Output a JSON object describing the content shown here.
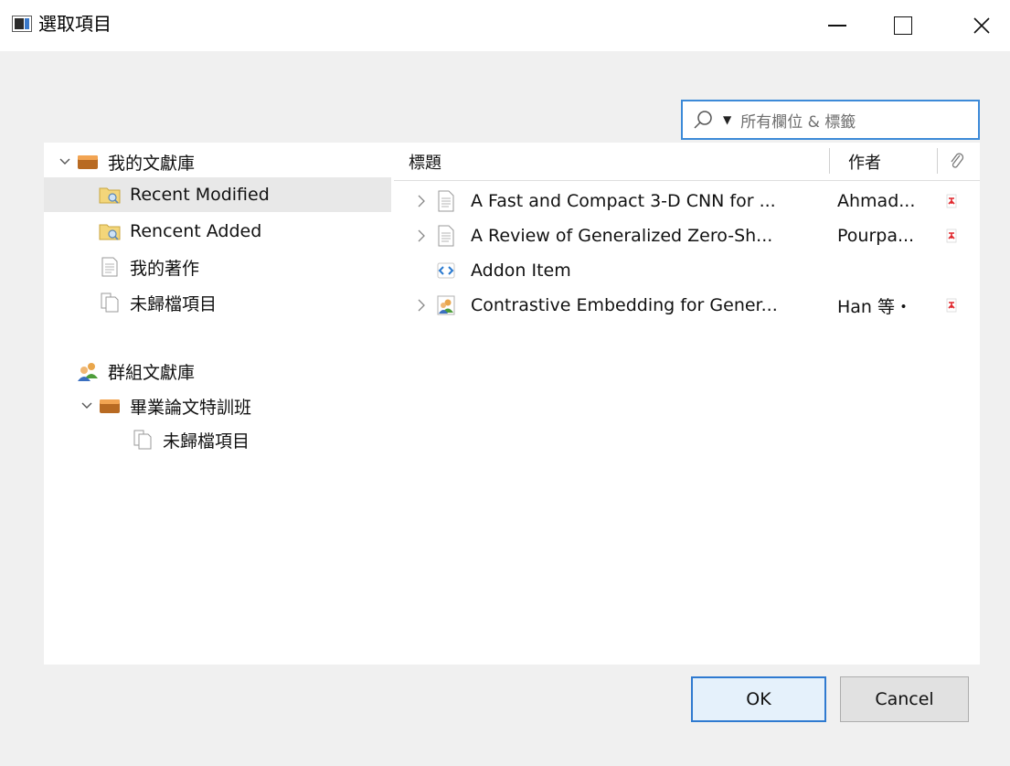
{
  "window": {
    "title": "選取項目"
  },
  "search": {
    "placeholder": "所有欄位 & 標籤"
  },
  "tree": {
    "my_library": "我的文獻庫",
    "items": [
      {
        "label": "Recent Modified",
        "selected": true
      },
      {
        "label": "Rencent Added",
        "selected": false
      },
      {
        "label": "我的著作",
        "selected": false
      },
      {
        "label": "未歸檔項目",
        "selected": false
      }
    ],
    "group_libraries": "群組文獻庫",
    "group": "畢業論文特訓班",
    "group_items": [
      {
        "label": "未歸檔項目"
      }
    ]
  },
  "table": {
    "headers": {
      "title": "標題",
      "author": "作者"
    },
    "rows": [
      {
        "title": "A Fast and Compact 3-D CNN for ...",
        "author": "Ahmad...",
        "has_pdf": true,
        "type": "document"
      },
      {
        "title": "A Review of Generalized Zero-Sh...",
        "author": "Pourpa...",
        "has_pdf": true,
        "type": "document"
      },
      {
        "title": "Addon Item",
        "author": "",
        "has_pdf": false,
        "type": "addon"
      },
      {
        "title": "Contrastive Embedding for Gener...",
        "author": "Han 等・",
        "has_pdf": true,
        "type": "conference"
      }
    ]
  },
  "buttons": {
    "ok": "OK",
    "cancel": "Cancel"
  },
  "colors": {
    "accent": "#2f7ad0",
    "pdf_red": "#e0282e",
    "folder_brown": "#b97a3a"
  }
}
